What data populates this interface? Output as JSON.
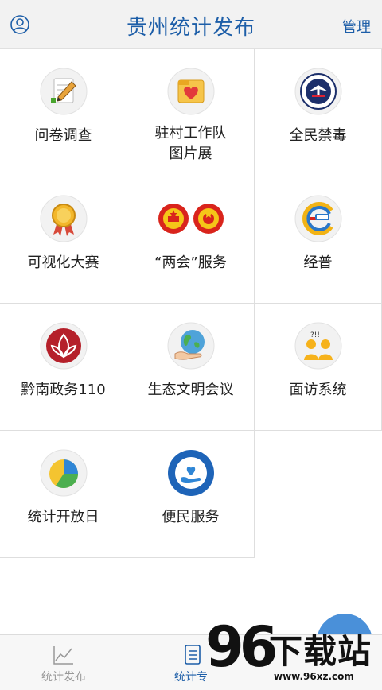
{
  "header": {
    "title": "贵州统计发布",
    "manage_label": "管理"
  },
  "grid": {
    "items": [
      {
        "label": "问卷调查",
        "icon": "pencil-notepad-icon"
      },
      {
        "label": "驻村工作队\n图片展",
        "icon": "heart-folder-icon"
      },
      {
        "label": "全民禁毒",
        "icon": "anti-drug-emblem-icon"
      },
      {
        "label": "可视化大赛",
        "icon": "medal-award-icon"
      },
      {
        "label": "“两会”服务",
        "icon": "national-emblem-icon"
      },
      {
        "label": "经普",
        "icon": "census-2018-logo-icon"
      },
      {
        "label": "黔南政务110",
        "icon": "leaf-logo-icon"
      },
      {
        "label": "生态文明会议",
        "icon": "earth-hands-icon"
      },
      {
        "label": "面访系统",
        "icon": "interview-people-icon"
      },
      {
        "label": "统计开放日",
        "icon": "pie-chart-icon"
      },
      {
        "label": "便民服务",
        "icon": "service-badge-icon"
      }
    ]
  },
  "tabbar": {
    "tabs": [
      {
        "label": "统计发布",
        "icon": "line-chart-icon",
        "active": false
      },
      {
        "label": "统计专",
        "icon": "document-icon",
        "active": true
      }
    ]
  },
  "watermark": {
    "number": "96",
    "text": "下载站",
    "url": "www.96xz.com"
  },
  "colors": {
    "accent": "#1d5ea8",
    "header_bg": "#f2f2f2",
    "tabbar_bg": "#f7f7f7",
    "grid_line": "#dedede"
  }
}
